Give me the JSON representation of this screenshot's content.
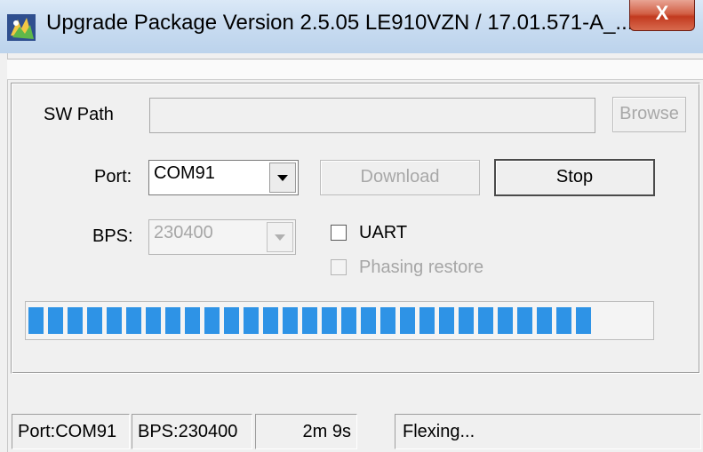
{
  "window": {
    "title": "Upgrade Package Version 2.5.05  LE910VZN / 17.01.571-A_...",
    "close_label": "X",
    "accent_color": "#c23a1f"
  },
  "form": {
    "sw_path_label": "SW Path",
    "sw_path_value": "",
    "browse_label": "Browse",
    "port_label": "Port:",
    "port_value": "COM91",
    "download_label": "Download",
    "stop_label": "Stop",
    "bps_label": "BPS:",
    "bps_value": "230400",
    "uart_label": "UART",
    "uart_checked": false,
    "phasing_label": "Phasing restore",
    "phasing_checked": false
  },
  "progress": {
    "filled_fraction": 0.95,
    "color": "#2e93e6"
  },
  "statusbar": {
    "port": "Port:COM91",
    "bps": "BPS:230400",
    "elapsed": "2m  9s",
    "state": "Flexing..."
  },
  "icons": [
    "app-icon",
    "close-icon",
    "dropdown-arrow-icon"
  ]
}
